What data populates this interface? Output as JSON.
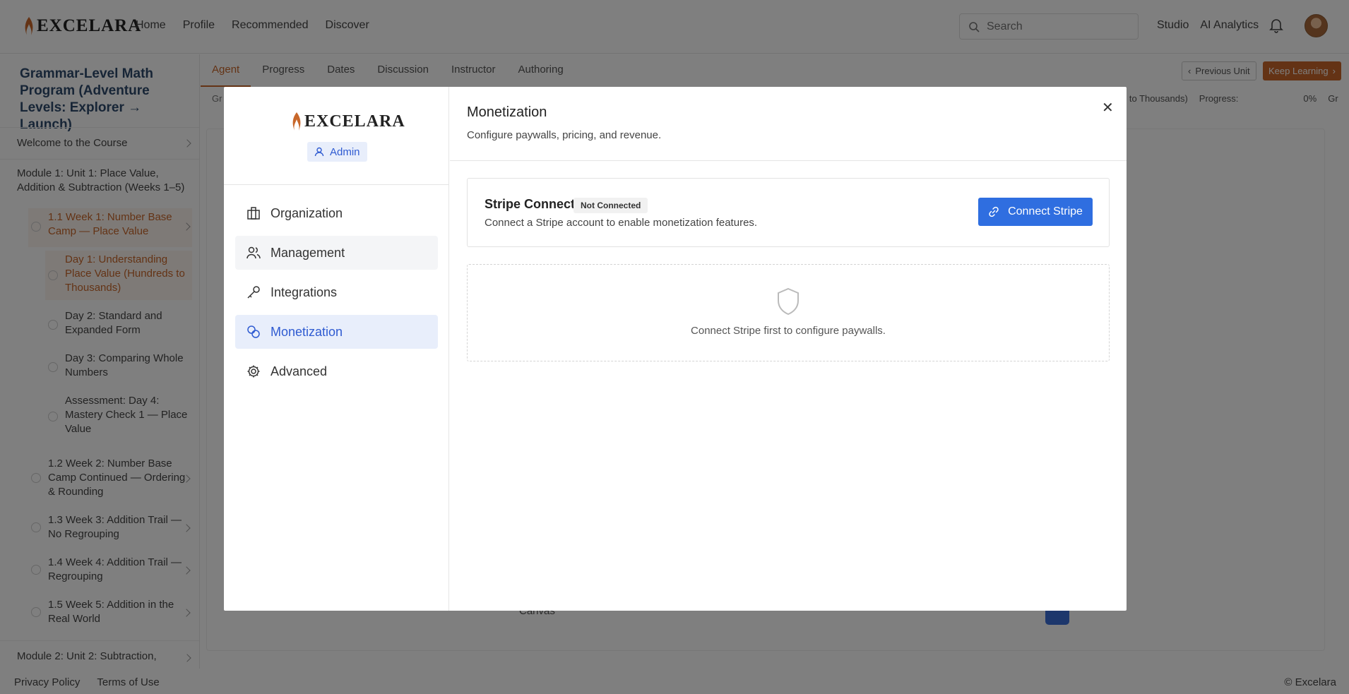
{
  "brand": {
    "name": "EXCELARA",
    "accent": "#c8672a",
    "primary": "#2f6ee0"
  },
  "topnav": {
    "links": [
      "Home",
      "Profile",
      "Recommended",
      "Discover"
    ],
    "search_placeholder": "Search",
    "right_links": [
      "Studio",
      "AI Analytics"
    ]
  },
  "sidebar": {
    "course_title": "Grammar-Level Math Program (Adventure Levels: Explorer → Launch)",
    "welcome": "Welcome to the Course",
    "module1": "Module 1: Unit 1: Place Value, Addition & Subtraction (Weeks 1–5)",
    "week1": "1.1 Week 1: Number Base Camp — Place Value",
    "day1": "Day 1: Understanding Place Value (Hundreds to Thousands)",
    "day2": "Day 2: Standard and Expanded Form",
    "day3": "Day 3: Comparing Whole Numbers",
    "assessment": "Assessment: Day 4: Mastery Check 1 — Place Value",
    "week2": "1.2 Week 2: Number Base Camp Continued — Ordering & Rounding",
    "week3": "1.3 Week 3: Addition Trail — No Regrouping",
    "week4": "1.4 Week 4: Addition Trail — Regrouping",
    "week5": "1.5 Week 5: Addition in the Real World",
    "module2": "Module 2: Unit 2: Subtraction,"
  },
  "footer": {
    "privacy": "Privacy Policy",
    "terms": "Terms of Use",
    "copyright": "© Excelara"
  },
  "main": {
    "tabs": [
      "Agent",
      "Progress",
      "Dates",
      "Discussion",
      "Instructor",
      "Authoring"
    ],
    "prev_unit": "Previous Unit",
    "keep_learning": "Keep Learning",
    "crumb_left": "Gr",
    "crumb_right_text": "reds to Thousands)",
    "progress_label": "Progress:",
    "progress_value": "0%",
    "crumb_tail": "Gr",
    "canvas_label": "Canvas"
  },
  "modal": {
    "role_badge": "Admin",
    "menu": [
      "Organization",
      "Management",
      "Integrations",
      "Monetization",
      "Advanced"
    ],
    "active_menu": "Monetization",
    "title": "Monetization",
    "subtitle": "Configure paywalls, pricing, and revenue.",
    "stripe": {
      "title": "Stripe Connect",
      "status": "Not Connected",
      "description": "Connect a Stripe account to enable monetization features.",
      "button": "Connect Stripe"
    },
    "empty_state": "Connect Stripe first to configure paywalls."
  }
}
